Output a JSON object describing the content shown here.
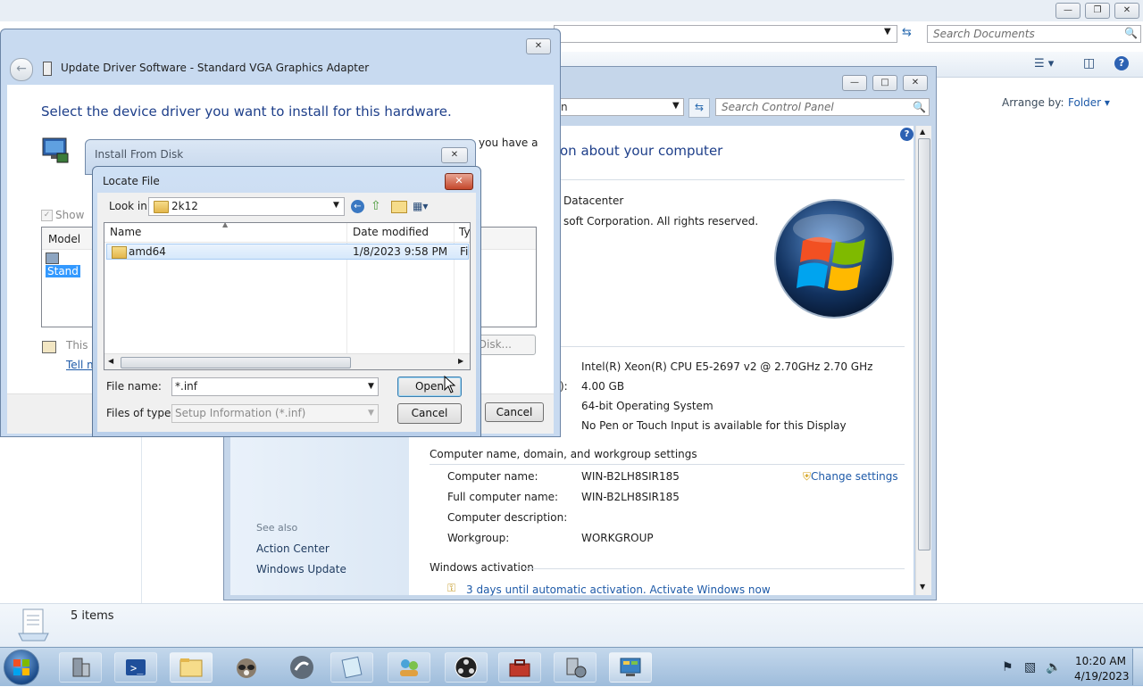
{
  "explorer": {
    "search_placeholder": "Search Documents",
    "arrange_by_label": "Arrange by:",
    "arrange_by_value": "Folder",
    "status_items": "5 items"
  },
  "control_panel": {
    "search_placeholder": "Search Control Panel",
    "address_partial": "n",
    "heading_partial": "on about your computer",
    "edition_partial": "Datacenter",
    "copyright_partial": "soft Corporation.  All rights reserved.",
    "processor": "Intel(R) Xeon(R) CPU E5-2697 v2 @ 2.70GHz   2.70 GHz",
    "memory_label_partial": "):",
    "memory": "4.00 GB",
    "system_type": "64-bit Operating System",
    "pen_touch": "No Pen or Touch Input is available for this Display",
    "computer_section": "Computer name, domain, and workgroup settings",
    "computer_name_label": "Computer name:",
    "computer_name": "WIN-B2LH8SIR185",
    "full_name_label": "Full computer name:",
    "full_name": "WIN-B2LH8SIR185",
    "description_label": "Computer description:",
    "workgroup_label": "Workgroup:",
    "workgroup": "WORKGROUP",
    "change_settings": "Change settings",
    "activation_section": "Windows activation",
    "activation_text": "3 days until automatic activation. Activate Windows now",
    "see_also": "See also",
    "action_center": "Action Center",
    "windows_update": "Windows Update"
  },
  "update_driver": {
    "title": "Update Driver Software - Standard VGA Graphics Adapter",
    "heading": "Select the device driver you want to install for this hardware.",
    "partial_text": "you have a",
    "show_partial": "Show",
    "model_header": "Model",
    "model_item_partial": "Stand",
    "this_partial": "This",
    "tell_partial": "Tell m",
    "have_disk_partial": "Disk...",
    "cancel": "Cancel"
  },
  "install_disk": {
    "title": "Install From Disk"
  },
  "locate_file": {
    "title": "Locate File",
    "look_in_label": "Look in:",
    "look_in_value": "2k12",
    "col_name": "Name",
    "col_date": "Date modified",
    "col_type_partial": "Ty",
    "rows": [
      {
        "name": "amd64",
        "date": "1/8/2023 9:58 PM",
        "type_partial": "Fi"
      }
    ],
    "file_name_label": "File name:",
    "file_name_value": "*.inf",
    "files_of_type_label": "Files of type:",
    "files_of_type_value": "Setup Information (*.inf)",
    "open": "Open",
    "cancel": "Cancel"
  },
  "taskbar": {
    "time": "10:20 AM",
    "date": "4/19/2023"
  },
  "colors": {
    "taskbar": "#a9c6e1",
    "link": "#1e5aa8",
    "heading": "#1e3f8a",
    "selection": "#3399ff"
  }
}
